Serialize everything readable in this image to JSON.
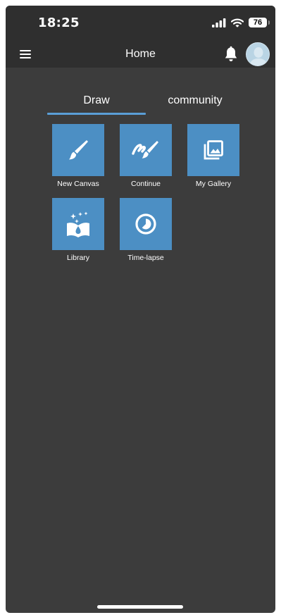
{
  "status_bar": {
    "time": "18:25",
    "battery": "76",
    "icons": [
      "signal-icon",
      "wifi-icon",
      "battery-icon"
    ]
  },
  "header": {
    "title": "Home",
    "left_icon": "menu-icon",
    "right_icons": [
      "bell-icon",
      "avatar"
    ]
  },
  "tabs": [
    {
      "label": "Draw",
      "selected": true
    },
    {
      "label": "community",
      "selected": false
    }
  ],
  "tiles": [
    {
      "label": "New Canvas",
      "icon": "paintbrush-icon"
    },
    {
      "label": "Continue",
      "icon": "paint-strokes-icon"
    },
    {
      "label": "My Gallery",
      "icon": "photo-library-icon"
    },
    {
      "label": "Library",
      "icon": "book-sparkle-icon"
    },
    {
      "label": "Time-lapse",
      "icon": "timelapse-icon"
    }
  ],
  "colors": {
    "background": "#3c3c3c",
    "header": "#2f2f2f",
    "tile": "#4c8fc4",
    "tab_indicator": "#5a9ed6"
  }
}
